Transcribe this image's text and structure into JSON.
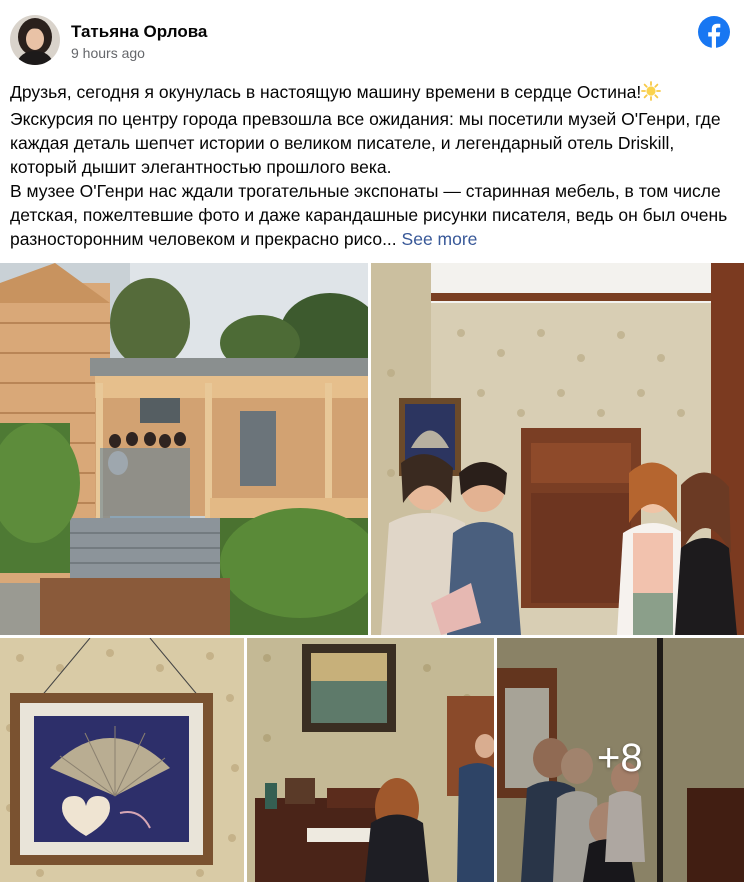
{
  "post": {
    "author": "Татьяна Орлова",
    "time": "9 hours ago",
    "lines": [
      "Друзья, сегодня я окунулась в настоящую машину времени в сердце Остина!",
      "Экскурсия по центру города превзошла все ожидания: мы посетили музей О'Генри, где",
      "каждая деталь шепчет истории о великом писателе, и легендарный отель Driskill,",
      "который дышит элегантностью прошлого века.",
      "В музее О'Генри нас ждали трогательные экспонаты — старинная мебель, в том числе",
      "детская, пожелтевшие фото и даже карандашные рисунки писателя, ведь он был очень",
      "разносторонним человеком и прекрасно рисо..."
    ],
    "see_more": "See more",
    "more_photos": "+8"
  },
  "icons": {
    "facebook": "facebook-logo-icon",
    "sun_emoji": "sun-emoji-icon"
  },
  "colors": {
    "facebook_blue": "#1877f2",
    "link": "#385898",
    "secondary_text": "#65676b"
  }
}
